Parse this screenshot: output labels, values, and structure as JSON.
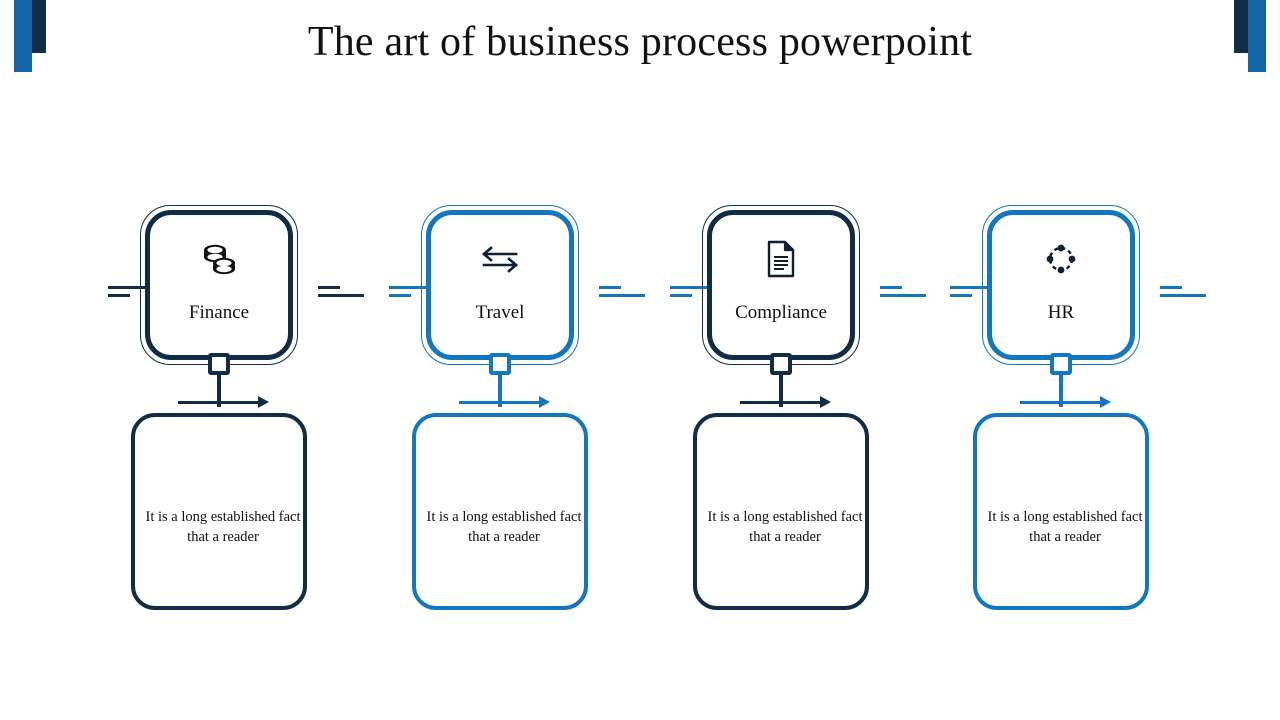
{
  "slide": {
    "title": "The art of business process powerpoint",
    "background": "#ffffff"
  },
  "theme": {
    "navy": "#112c45",
    "blue": "#1277bf",
    "deco_blue": "#1266a8",
    "deco_navy": "#112c45",
    "text": "#111111"
  },
  "decorations": {
    "left_corner_name": "left-corner-accent",
    "right_corner_name": "right-corner-accent"
  },
  "columns": [
    {
      "label": "Finance",
      "icon": "stacked-coins-icon",
      "color": "#112c45",
      "line_color": "#112c45",
      "description": "It is a long established fact that a reader"
    },
    {
      "label": "Travel",
      "icon": "exchange-arrows-icon",
      "color": "#1277bf",
      "line_color": "#1277bf",
      "description": "It is a long established fact that a reader"
    },
    {
      "label": "Compliance",
      "icon": "document-icon",
      "color": "#112c45",
      "line_color": "#1277bf",
      "description": "It is a long established fact that a reader"
    },
    {
      "label": "HR",
      "icon": "network-dots-icon",
      "color": "#1277bf",
      "line_color": "#1277bf",
      "description": "It is a long established fact that a reader"
    }
  ]
}
